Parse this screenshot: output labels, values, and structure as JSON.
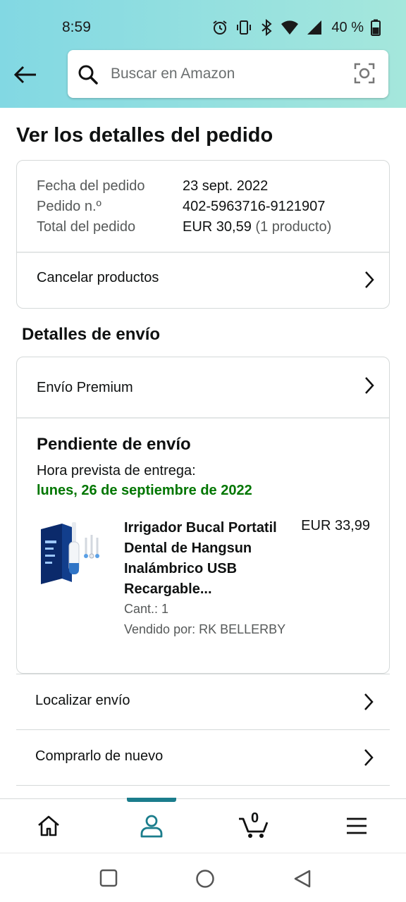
{
  "status_bar": {
    "time": "8:59",
    "battery": "40 %"
  },
  "search": {
    "placeholder": "Buscar en Amazon"
  },
  "page": {
    "title": "Ver los detalles del pedido"
  },
  "order_summary": {
    "date_label": "Fecha del pedido",
    "date_value": "23 sept. 2022",
    "number_label": "Pedido n.º",
    "number_value": "402-5963716-9121907",
    "total_label": "Total del pedido",
    "total_value": "EUR 30,59",
    "total_items": "(1 producto)",
    "cancel_label": "Cancelar productos"
  },
  "shipping": {
    "section_title": "Detalles de envío",
    "method": "Envío Premium",
    "status": "Pendiente de envío",
    "delivery_label": "Hora prevista de entrega:",
    "delivery_date": "lunes, 26 de septiembre de 2022"
  },
  "product": {
    "title": "Irrigador Bucal Portatil Dental de Hangsun Inalámbrico USB Recargable...",
    "price": "EUR 33,99",
    "quantity": "Cant.: 1",
    "seller": "Vendido por: RK BELLERBY"
  },
  "actions": {
    "track": "Localizar envío",
    "buy_again": "Comprarlo de nuevo"
  },
  "bottom_nav": {
    "cart_count": "0",
    "active": "account"
  },
  "colors": {
    "accent": "#1b7d8c",
    "delivery_green": "#007600",
    "header_start": "#82d8e3",
    "header_end": "#a5e7dc"
  }
}
